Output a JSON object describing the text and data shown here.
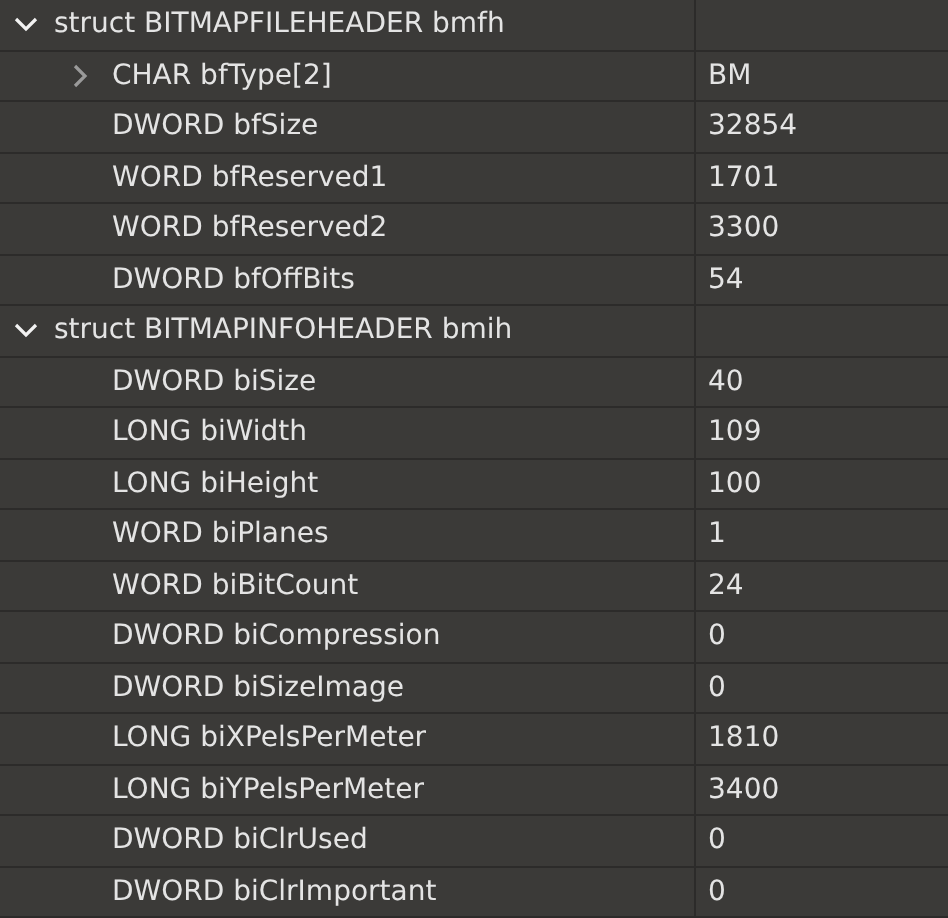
{
  "structs": [
    {
      "label": "struct BITMAPFILEHEADER bmfh",
      "expanded": true,
      "children": [
        {
          "kind": "array",
          "expanded": false,
          "label": "CHAR bfType[2]",
          "value": "BM"
        },
        {
          "kind": "scalar",
          "label": "DWORD bfSize",
          "value": "32854"
        },
        {
          "kind": "scalar",
          "label": "WORD bfReserved1",
          "value": "1701"
        },
        {
          "kind": "scalar",
          "label": "WORD bfReserved2",
          "value": "3300"
        },
        {
          "kind": "scalar",
          "label": "DWORD bfOffBits",
          "value": "54"
        }
      ]
    },
    {
      "label": "struct BITMAPINFOHEADER bmih",
      "expanded": true,
      "children": [
        {
          "kind": "scalar",
          "label": "DWORD biSize",
          "value": "40"
        },
        {
          "kind": "scalar",
          "label": "LONG biWidth",
          "value": "109"
        },
        {
          "kind": "scalar",
          "label": "LONG biHeight",
          "value": "100"
        },
        {
          "kind": "scalar",
          "label": "WORD biPlanes",
          "value": "1"
        },
        {
          "kind": "scalar",
          "label": "WORD biBitCount",
          "value": "24"
        },
        {
          "kind": "scalar",
          "label": "DWORD biCompression",
          "value": "0"
        },
        {
          "kind": "scalar",
          "label": "DWORD biSizeImage",
          "value": "0"
        },
        {
          "kind": "scalar",
          "label": "LONG biXPelsPerMeter",
          "value": "1810"
        },
        {
          "kind": "scalar",
          "label": "LONG biYPelsPerMeter",
          "value": "3400"
        },
        {
          "kind": "scalar",
          "label": "DWORD biClrUsed",
          "value": "0"
        },
        {
          "kind": "scalar",
          "label": "DWORD biClrImportant",
          "value": "0"
        }
      ]
    }
  ]
}
